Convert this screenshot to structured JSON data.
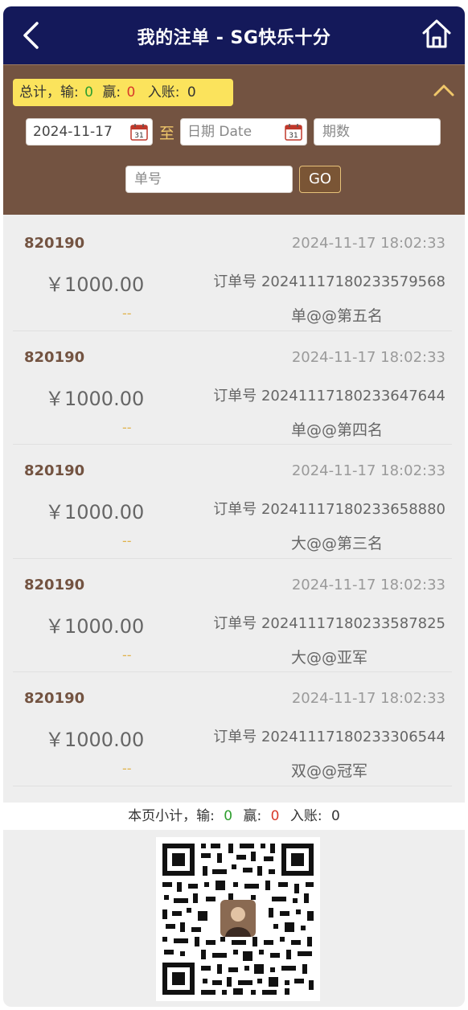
{
  "header": {
    "title": "我的注单 - SG快乐十分"
  },
  "filter": {
    "summary": {
      "total_label": "总计，输:",
      "lose_value": "0",
      "win_label": "赢:",
      "win_value": "0",
      "deposit_label": "入账:",
      "deposit_value": "0"
    },
    "date_from": "2024-11-17",
    "to_label": "至",
    "date_to_placeholder": "日期 Date",
    "issue_placeholder": "期数",
    "order_placeholder": "单号",
    "go_label": "GO"
  },
  "records": [
    {
      "issue": "820190",
      "time": "2024-11-17 18:02:33",
      "amount": "￥1000.00",
      "order": "订单号 20241117180233579568",
      "result": "--",
      "bet": "单@@第五名"
    },
    {
      "issue": "820190",
      "time": "2024-11-17 18:02:33",
      "amount": "￥1000.00",
      "order": "订单号 20241117180233647644",
      "result": "--",
      "bet": "单@@第四名"
    },
    {
      "issue": "820190",
      "time": "2024-11-17 18:02:33",
      "amount": "￥1000.00",
      "order": "订单号 20241117180233658880",
      "result": "--",
      "bet": "大@@第三名"
    },
    {
      "issue": "820190",
      "time": "2024-11-17 18:02:33",
      "amount": "￥1000.00",
      "order": "订单号 20241117180233587825",
      "result": "--",
      "bet": "大@@亚军"
    },
    {
      "issue": "820190",
      "time": "2024-11-17 18:02:33",
      "amount": "￥1000.00",
      "order": "订单号 20241117180233306544",
      "result": "--",
      "bet": "双@@冠军"
    }
  ],
  "page_total": {
    "label": "本页小计，输:",
    "lose_value": "0",
    "win_label": "赢:",
    "win_value": "0",
    "deposit_label": "入账:",
    "deposit_value": "0"
  },
  "colors": {
    "header_bg": "#14195a",
    "filter_bg": "#735341",
    "badge_bg": "#fbe35c",
    "issue_text": "#735341"
  },
  "icons": [
    "back-arrow-icon",
    "home-icon",
    "chevron-up-icon",
    "calendar-icon",
    "qr-code-icon"
  ]
}
